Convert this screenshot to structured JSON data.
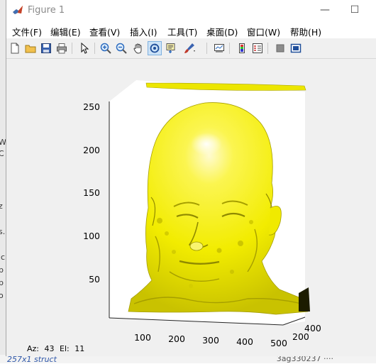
{
  "window": {
    "title": "Figure 1",
    "minimize_glyph": "—",
    "maximize_glyph": "☐"
  },
  "menu": [
    {
      "label": "文件(F)"
    },
    {
      "label": "编辑(E)"
    },
    {
      "label": "查看(V)"
    },
    {
      "label": "插入(I)"
    },
    {
      "label": "工具(T)"
    },
    {
      "label": "桌面(D)"
    },
    {
      "label": "窗口(W)"
    },
    {
      "label": "帮助(H)"
    }
  ],
  "toolbar": [
    {
      "name": "new-figure-icon"
    },
    {
      "name": "open-file-icon"
    },
    {
      "name": "save-icon"
    },
    {
      "name": "print-icon"
    },
    {
      "name": "edit-plot-arrow-icon"
    },
    {
      "name": "zoom-in-icon"
    },
    {
      "name": "zoom-out-icon"
    },
    {
      "name": "pan-hand-icon"
    },
    {
      "name": "rotate-3d-icon",
      "active": true
    },
    {
      "name": "data-cursor-icon"
    },
    {
      "name": "brush-icon"
    },
    {
      "name": "link-plot-icon"
    },
    {
      "name": "insert-colorbar-icon"
    },
    {
      "name": "insert-legend-icon"
    },
    {
      "name": "hide-plot-tools-icon"
    },
    {
      "name": "show-plot-tools-icon"
    }
  ],
  "plot": {
    "surface_color": "#f4f000",
    "z_ticks": [
      "250",
      "200",
      "150",
      "100",
      "50"
    ],
    "x_ticks": [
      "100",
      "200",
      "300",
      "400",
      "500"
    ],
    "y_ticks": [
      "200",
      "400"
    ]
  },
  "status": {
    "az_label": "Az:",
    "az_value": "43",
    "el_label": "El:",
    "el_value": "11"
  },
  "background": {
    "left_chars": [
      "W",
      "C",
      "z",
      "s.",
      "ic",
      "p",
      "p",
      "o"
    ],
    "bottom_text": "257x1 struct",
    "bottom_right": "3ag330237    ····"
  }
}
